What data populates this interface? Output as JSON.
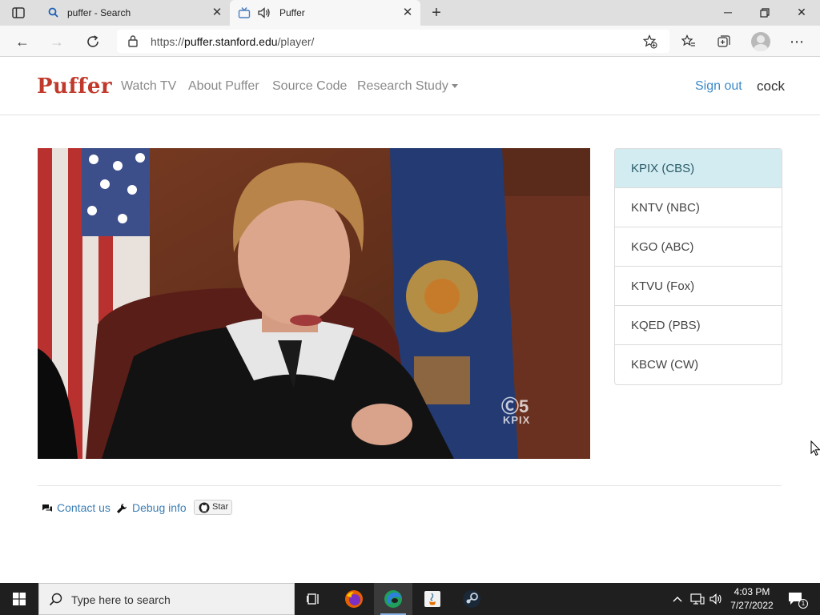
{
  "browser": {
    "tabs": [
      {
        "title": "puffer - Search",
        "active": false
      },
      {
        "title": "Puffer",
        "active": true
      }
    ],
    "url_prefix": "https://",
    "url_host": "puffer.stanford.edu",
    "url_path": "/player/"
  },
  "site": {
    "brand": "Puffer",
    "nav": {
      "watch_tv": "Watch TV",
      "about": "About Puffer",
      "source": "Source Code",
      "research": "Research Study"
    },
    "sign_out": "Sign out",
    "username": "cock",
    "watermark_channel": "KPIX",
    "channels": [
      {
        "label": "KPIX (CBS)",
        "active": true
      },
      {
        "label": "KNTV (NBC)",
        "active": false
      },
      {
        "label": "KGO (ABC)",
        "active": false
      },
      {
        "label": "KTVU (Fox)",
        "active": false
      },
      {
        "label": "KQED (PBS)",
        "active": false
      },
      {
        "label": "KBCW (CW)",
        "active": false
      }
    ],
    "footer": {
      "contact": "Contact us",
      "debug": "Debug info",
      "star": "Star"
    }
  },
  "taskbar": {
    "search_placeholder": "Type here to search",
    "time": "4:03 PM",
    "date": "7/27/2022",
    "notification_count": "1"
  },
  "colors": {
    "brand": "#c0392b",
    "link": "#3d8bc9",
    "active_channel_bg": "#d2ecf1"
  }
}
